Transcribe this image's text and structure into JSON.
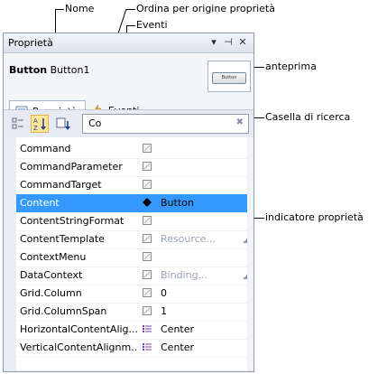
{
  "callouts": {
    "nome": "Nome",
    "ordina": "Ordina per origine proprietà",
    "eventi": "Eventi",
    "anteprima": "anteprima",
    "casella": "Casella di ricerca",
    "indicatore": "indicatore proprietà"
  },
  "panel": {
    "title": "Proprietà",
    "object_type": "Button",
    "object_name": "Button1",
    "preview_label": "Button",
    "tabs": [
      {
        "label": "Proprietà",
        "icon": "properties-icon"
      },
      {
        "label": "Eventi",
        "icon": "lightning-icon"
      }
    ],
    "search_value": "Co"
  },
  "properties": [
    {
      "name": "Command",
      "value": "",
      "marker": "square",
      "dropdown": false
    },
    {
      "name": "CommandParameter",
      "value": "",
      "marker": "square",
      "dropdown": false
    },
    {
      "name": "CommandTarget",
      "value": "",
      "marker": "square",
      "dropdown": false
    },
    {
      "name": "Content",
      "value": "Button",
      "marker": "diamond",
      "dropdown": false,
      "selected": true
    },
    {
      "name": "ContentStringFormat",
      "value": "",
      "marker": "square",
      "dropdown": false
    },
    {
      "name": "ContentTemplate",
      "value": "Resource...",
      "marker": "square",
      "dropdown": true,
      "gray": true
    },
    {
      "name": "ContextMenu",
      "value": "",
      "marker": "square",
      "dropdown": false
    },
    {
      "name": "DataContext",
      "value": "Binding...",
      "marker": "square",
      "dropdown": true,
      "gray": true
    },
    {
      "name": "Grid.Column",
      "value": "0",
      "marker": "square",
      "dropdown": false
    },
    {
      "name": "Grid.ColumnSpan",
      "value": "1",
      "marker": "square",
      "dropdown": false
    },
    {
      "name": "HorizontalContentAlig...",
      "value": "Center",
      "marker": "lines",
      "dropdown": false
    },
    {
      "name": "VerticalContentAlignm...",
      "value": "Center",
      "marker": "lines",
      "dropdown": false
    }
  ],
  "colors": {
    "selected": "#3399ff",
    "accent": "#8d99ad"
  }
}
